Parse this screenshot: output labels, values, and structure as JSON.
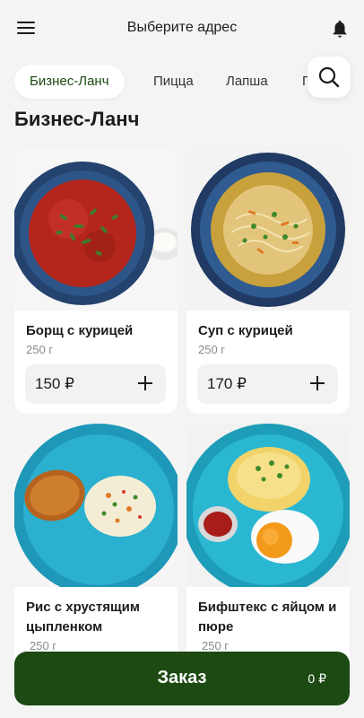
{
  "header": {
    "title": "Выберите адрес",
    "menu_icon": "hamburger-menu-icon",
    "notification_icon": "bell-icon"
  },
  "categories": [
    {
      "label": "Бизнес-Ланч",
      "active": true
    },
    {
      "label": "Пицца",
      "active": false
    },
    {
      "label": "Лапша",
      "active": false
    },
    {
      "label": "П",
      "active": false
    }
  ],
  "search_icon": "search-icon",
  "section_title": "Бизнес-Ланч",
  "products": [
    {
      "name": "Борщ с курицей",
      "weight": "250 г",
      "price": "150 ₽"
    },
    {
      "name": "Суп с курицей",
      "weight": "250 г",
      "price": "170 ₽"
    },
    {
      "name": "Рис с хрустящим цыпленком",
      "weight": "250 г",
      "price": ""
    },
    {
      "name": "Бифштекс с яйцом и пюре",
      "weight": "250 г",
      "price": ""
    }
  ],
  "order": {
    "label": "Заказ",
    "total": "0 ₽"
  },
  "colors": {
    "accent": "#1c4a12",
    "background": "#f4f4f4",
    "card": "#ffffff"
  }
}
